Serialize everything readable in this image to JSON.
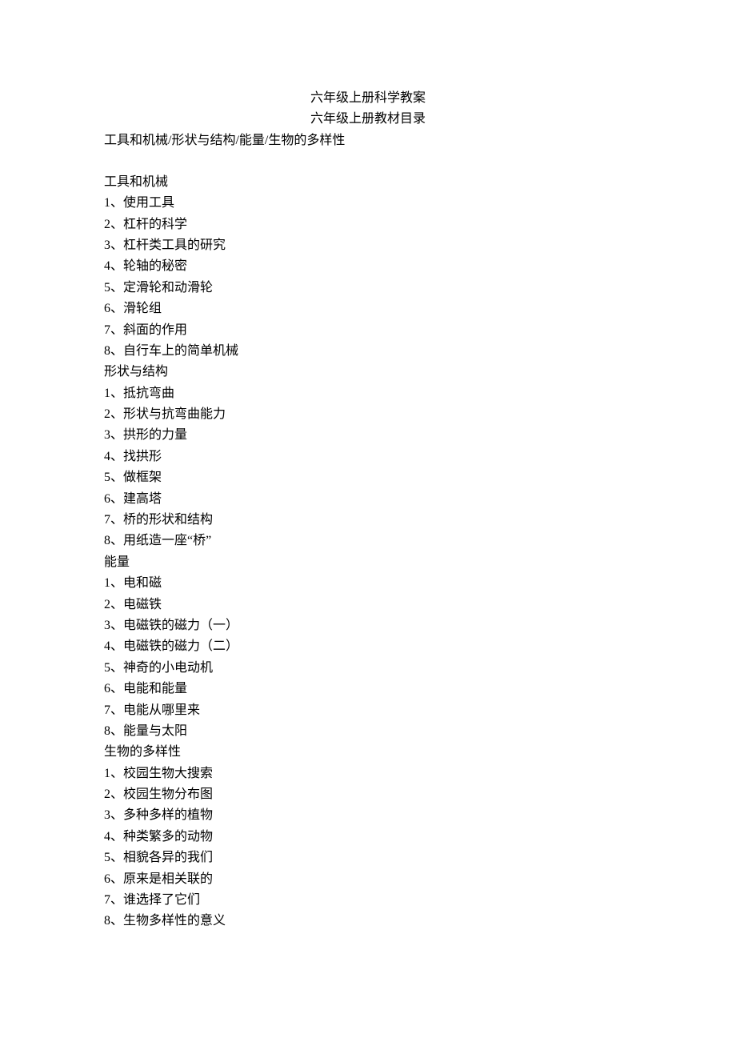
{
  "title1": "六年级上册科学教案",
  "title2": "六年级上册教材目录",
  "summary": "工具和机械/形状与结构/能量/生物的多样性",
  "sections": [
    {
      "heading": "工具和机械",
      "items": [
        "1、使用工具",
        "2、杠杆的科学",
        "3、杠杆类工具的研究",
        "4、轮轴的秘密",
        "5、定滑轮和动滑轮",
        "6、滑轮组",
        "7、斜面的作用",
        "8、自行车上的简单机械"
      ]
    },
    {
      "heading": "形状与结构",
      "items": [
        "1、抵抗弯曲",
        "2、形状与抗弯曲能力",
        "3、拱形的力量",
        "4、找拱形",
        "5、做框架",
        "6、建高塔",
        "7、桥的形状和结构",
        "8、用纸造一座“桥”"
      ]
    },
    {
      "heading": "能量",
      "items": [
        "1、电和磁",
        "2、电磁铁",
        "3、电磁铁的磁力（一）",
        "4、电磁铁的磁力（二）",
        "5、神奇的小电动机",
        "6、电能和能量",
        "7、电能从哪里来",
        "8、能量与太阳"
      ]
    },
    {
      "heading": "生物的多样性",
      "items": [
        "1、校园生物大搜索",
        "2、校园生物分布图",
        "3、多种多样的植物",
        "4、种类繁多的动物",
        "5、相貌各异的我们",
        "6、原来是相关联的",
        "7、谁选择了它们",
        "8、生物多样性的意义"
      ]
    }
  ]
}
